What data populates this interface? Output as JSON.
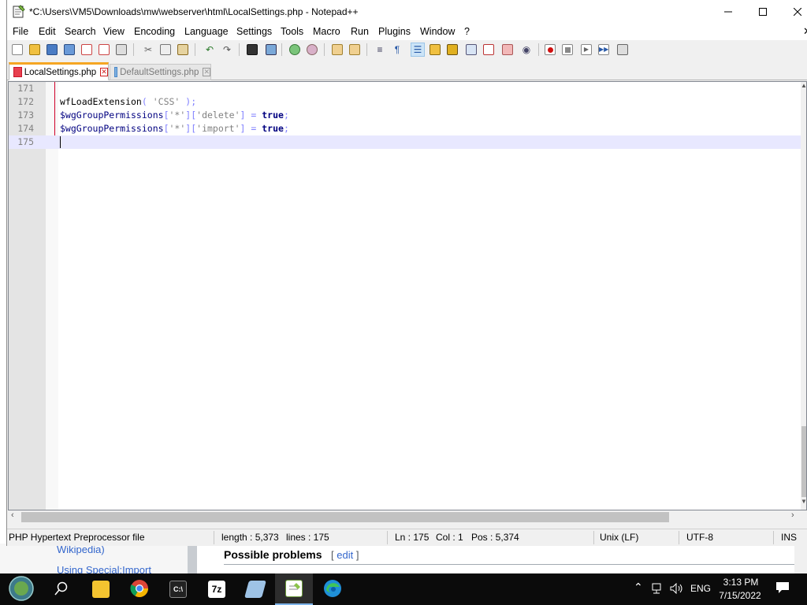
{
  "window": {
    "title": "*C:\\Users\\VM5\\Downloads\\mw\\webserver\\html\\LocalSettings.php - Notepad++"
  },
  "menu": [
    "File",
    "Edit",
    "Search",
    "View",
    "Encoding",
    "Language",
    "Settings",
    "Tools",
    "Macro",
    "Run",
    "Plugins",
    "Window",
    "?"
  ],
  "tabs": [
    {
      "label": "LocalSettings.php",
      "active": true
    },
    {
      "label": "DefaultSettings.php",
      "active": false
    }
  ],
  "editor": {
    "lines": [
      {
        "number": "171"
      },
      {
        "number": "172",
        "tokens": [
          [
            "fn",
            "wfLoadExtension"
          ],
          [
            "op",
            "( "
          ],
          [
            "str",
            "'CSS'"
          ],
          [
            "op",
            " );"
          ]
        ]
      },
      {
        "number": "173",
        "tokens": [
          [
            "var",
            "$wgGroupPermissions"
          ],
          [
            "op",
            "["
          ],
          [
            "str",
            "'*'"
          ],
          [
            "op",
            "]["
          ],
          [
            "str",
            "'delete'"
          ],
          [
            "op",
            "] = "
          ],
          [
            "kw",
            "true"
          ],
          [
            "op",
            ";"
          ]
        ]
      },
      {
        "number": "174",
        "tokens": [
          [
            "var",
            "$wgGroupPermissions"
          ],
          [
            "op",
            "["
          ],
          [
            "str",
            "'*'"
          ],
          [
            "op",
            "]["
          ],
          [
            "str",
            "'import'"
          ],
          [
            "op",
            "] = "
          ],
          [
            "kw",
            "true"
          ],
          [
            "op",
            ";"
          ]
        ]
      },
      {
        "number": "175",
        "current": true
      }
    ]
  },
  "status": {
    "file_type": "PHP Hypertext Preprocessor file",
    "length": "length : 5,373",
    "lines": "lines : 175",
    "ln": "Ln : 175",
    "col": "Col : 1",
    "pos": "Pos : 5,374",
    "eol": "Unix (LF)",
    "encoding": "UTF-8",
    "mode": "INS"
  },
  "background_page": {
    "wikipedia_link": "Wikipedia)",
    "import_link": "Using Special:Import",
    "heading": "Possible problems",
    "edit_open": "[ ",
    "edit_link": "edit",
    "edit_close": " ]"
  },
  "taskbar": {
    "language": "ENG",
    "time": "3:13 PM",
    "date": "7/15/2022",
    "icons": [
      "start-orb-icon",
      "search-icon",
      "file-explorer-icon",
      "chrome-icon",
      "terminal-icon",
      "7zip-icon",
      "pen-app-icon",
      "notepadpp-icon",
      "edge-icon"
    ]
  },
  "colors": {
    "active_tab_accent": "#f5a623",
    "current_line": "#e8e8ff",
    "fold_marker": "#d0002a",
    "keyword": "#000080"
  }
}
